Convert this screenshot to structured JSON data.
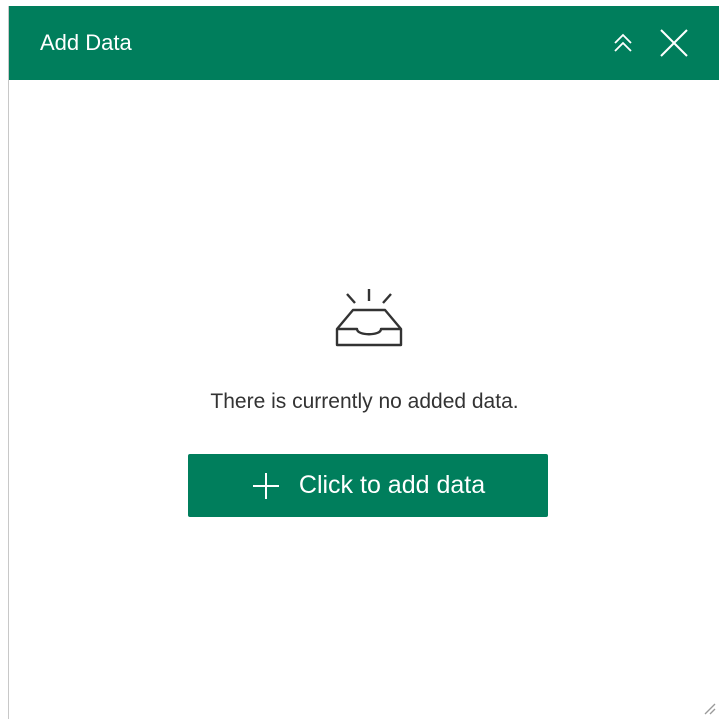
{
  "panel": {
    "title": "Add Data",
    "header_color": "#007e5c",
    "actions": {
      "collapse_icon": "double-chevron-up-icon",
      "close_icon": "close-icon"
    }
  },
  "empty_state": {
    "icon": "empty-inbox-icon",
    "message": "There is currently no added data.",
    "add_button": {
      "icon": "plus-icon",
      "label": "Click to add data",
      "color": "#007e5c"
    }
  },
  "footer": {
    "resize_icon": "resize-grip-icon"
  }
}
